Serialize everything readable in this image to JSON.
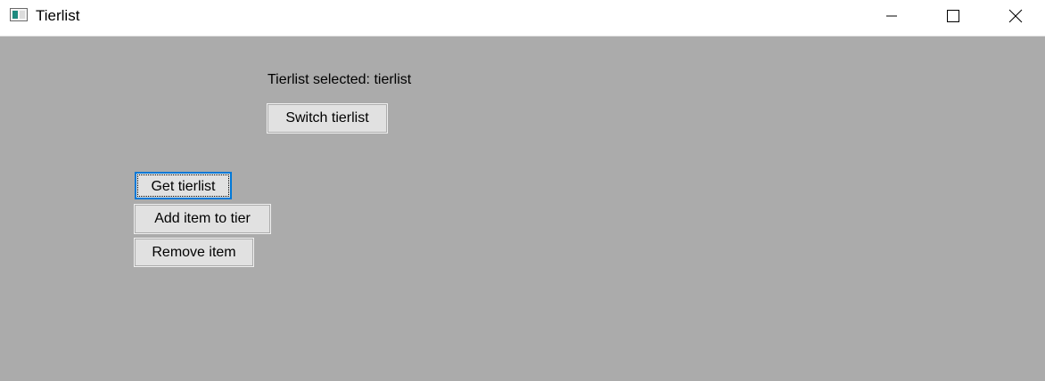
{
  "window": {
    "title": "Tierlist",
    "icon": "app-window-icon",
    "controls": [
      "minimize-icon",
      "maximize-icon",
      "close-icon"
    ]
  },
  "main": {
    "selected_label": "Tierlist selected: tierlist",
    "switch_button": "Switch tierlist",
    "get_button": "Get tierlist",
    "add_button": "Add item to tier",
    "remove_button": "Remove item"
  },
  "colors": {
    "background": "#ababab",
    "titlebar": "#ffffff",
    "button_face": "#e1e1e1",
    "focus_border": "#0078d7"
  }
}
